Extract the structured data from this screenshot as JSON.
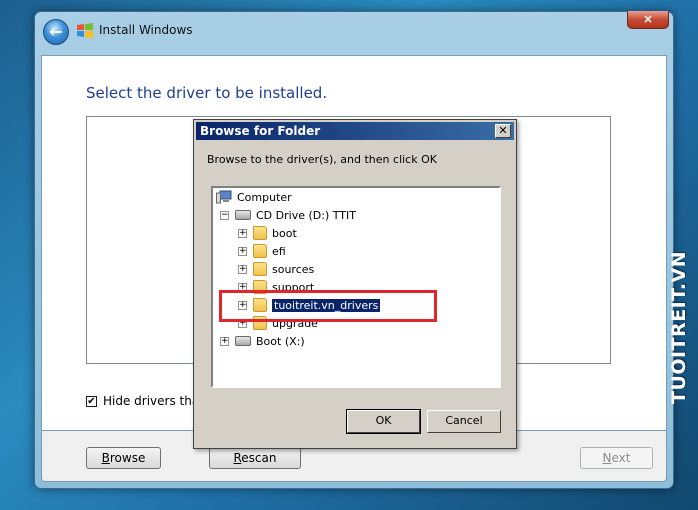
{
  "window": {
    "title": "Install Windows",
    "close_glyph": "×",
    "back_glyph": "←",
    "back_icon": "back-arrow-icon",
    "logo_icon": "windows-logo-icon"
  },
  "main": {
    "heading": "Select the driver to be installed.",
    "hide_checkbox": {
      "checked": true,
      "glyph": "✔",
      "label": "Hide drivers that a"
    }
  },
  "footer": {
    "browse_accel": "B",
    "browse_rest": "rowse",
    "rescan_accel": "R",
    "rescan_rest": "escan",
    "next_accel": "N",
    "next_rest": "ext"
  },
  "dialog": {
    "title": "Browse for Folder",
    "close_glyph": "✕",
    "instruction": "Browse to the driver(s), and then click OK",
    "tree": {
      "root": "Computer",
      "cd_drive": "CD Drive (D:) TTIT",
      "folders": [
        "boot",
        "efi",
        "sources",
        "support",
        "tuoitreit.vn_drivers",
        "upgrade"
      ],
      "selected": "tuoitreit.vn_drivers",
      "boot_drive": "Boot (X:)",
      "expand_glyph": "+",
      "collapse_glyph": "−"
    },
    "ok_label": "OK",
    "cancel_label": "Cancel"
  },
  "watermark": {
    "text": "TUOITREIT.VN"
  },
  "colors": {
    "heading": "#1e3f8f",
    "dialog_titlebar": "#0a246a",
    "selection": "#0a246a",
    "highlight_box": "#e1252c"
  }
}
